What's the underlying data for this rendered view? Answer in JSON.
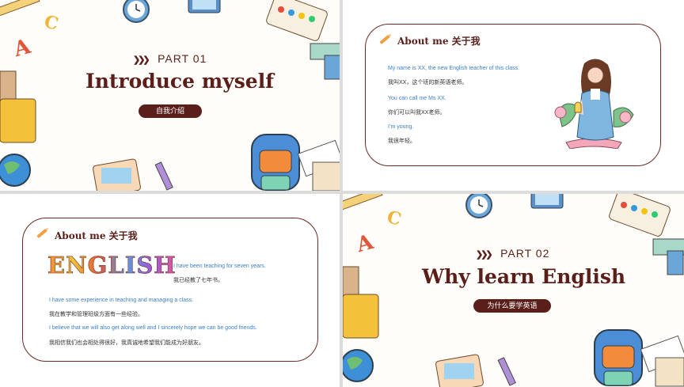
{
  "slide1": {
    "part_label": "PART  01",
    "title": "Introduce myself",
    "subtitle_pill": "自我介绍",
    "deco_letters": [
      "A",
      "C"
    ]
  },
  "slide2": {
    "heading": "About me 关于我",
    "lines": [
      {
        "en": "My name is XX, the new English teacher of this class.",
        "zh": "我叫XX，这个班的新英语老师。"
      },
      {
        "en": "You can call me Ms XX.",
        "zh": "你们可以叫我XX老师。"
      },
      {
        "en": "I’m young.",
        "zh": "我很年轻。"
      }
    ]
  },
  "slide3": {
    "heading": "About me 关于我",
    "logo_word": "ENGLISH",
    "lines": [
      {
        "en": "I have been teaching for seven years.",
        "zh": "我已经教了七年书。"
      },
      {
        "en": "I have some experience in teaching and managing a class.",
        "zh": "我在教学和管理班级方面有一些经验。"
      },
      {
        "en": "I believe that we will also get along well and I sincerely hope we can be good friends.",
        "zh": "我相信我们也会相处得很好，我真诚地希望我们能成为好朋友。"
      }
    ]
  },
  "slide4": {
    "part_label": "PART  02",
    "title": "Why learn English",
    "subtitle_pill": "为什么要学英语",
    "deco_letters": [
      "A",
      "C"
    ]
  },
  "colors": {
    "brand": "#5a1f1a",
    "link_blue": "#3a7fc4",
    "accent_orange": "#f0a040"
  }
}
